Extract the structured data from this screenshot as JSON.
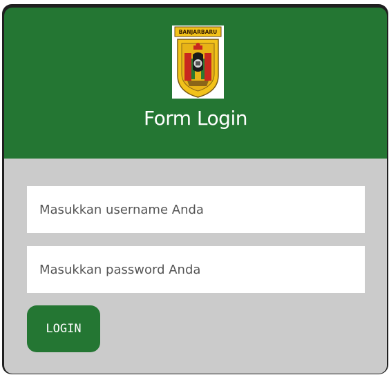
{
  "header": {
    "emblem_text": "BANJARBARU",
    "title": "Form Login"
  },
  "form": {
    "username_placeholder": "Masukkan username Anda",
    "password_placeholder": "Masukkan password Anda",
    "login_label": "LOGIN"
  },
  "colors": {
    "header_green": "#247633",
    "panel_gray": "#cbcbcb",
    "button_green": "#247633",
    "emblem_yellow": "#f2c21a",
    "emblem_red": "#c8281e"
  },
  "icons": [
    "banjarbaru-emblem-icon"
  ]
}
